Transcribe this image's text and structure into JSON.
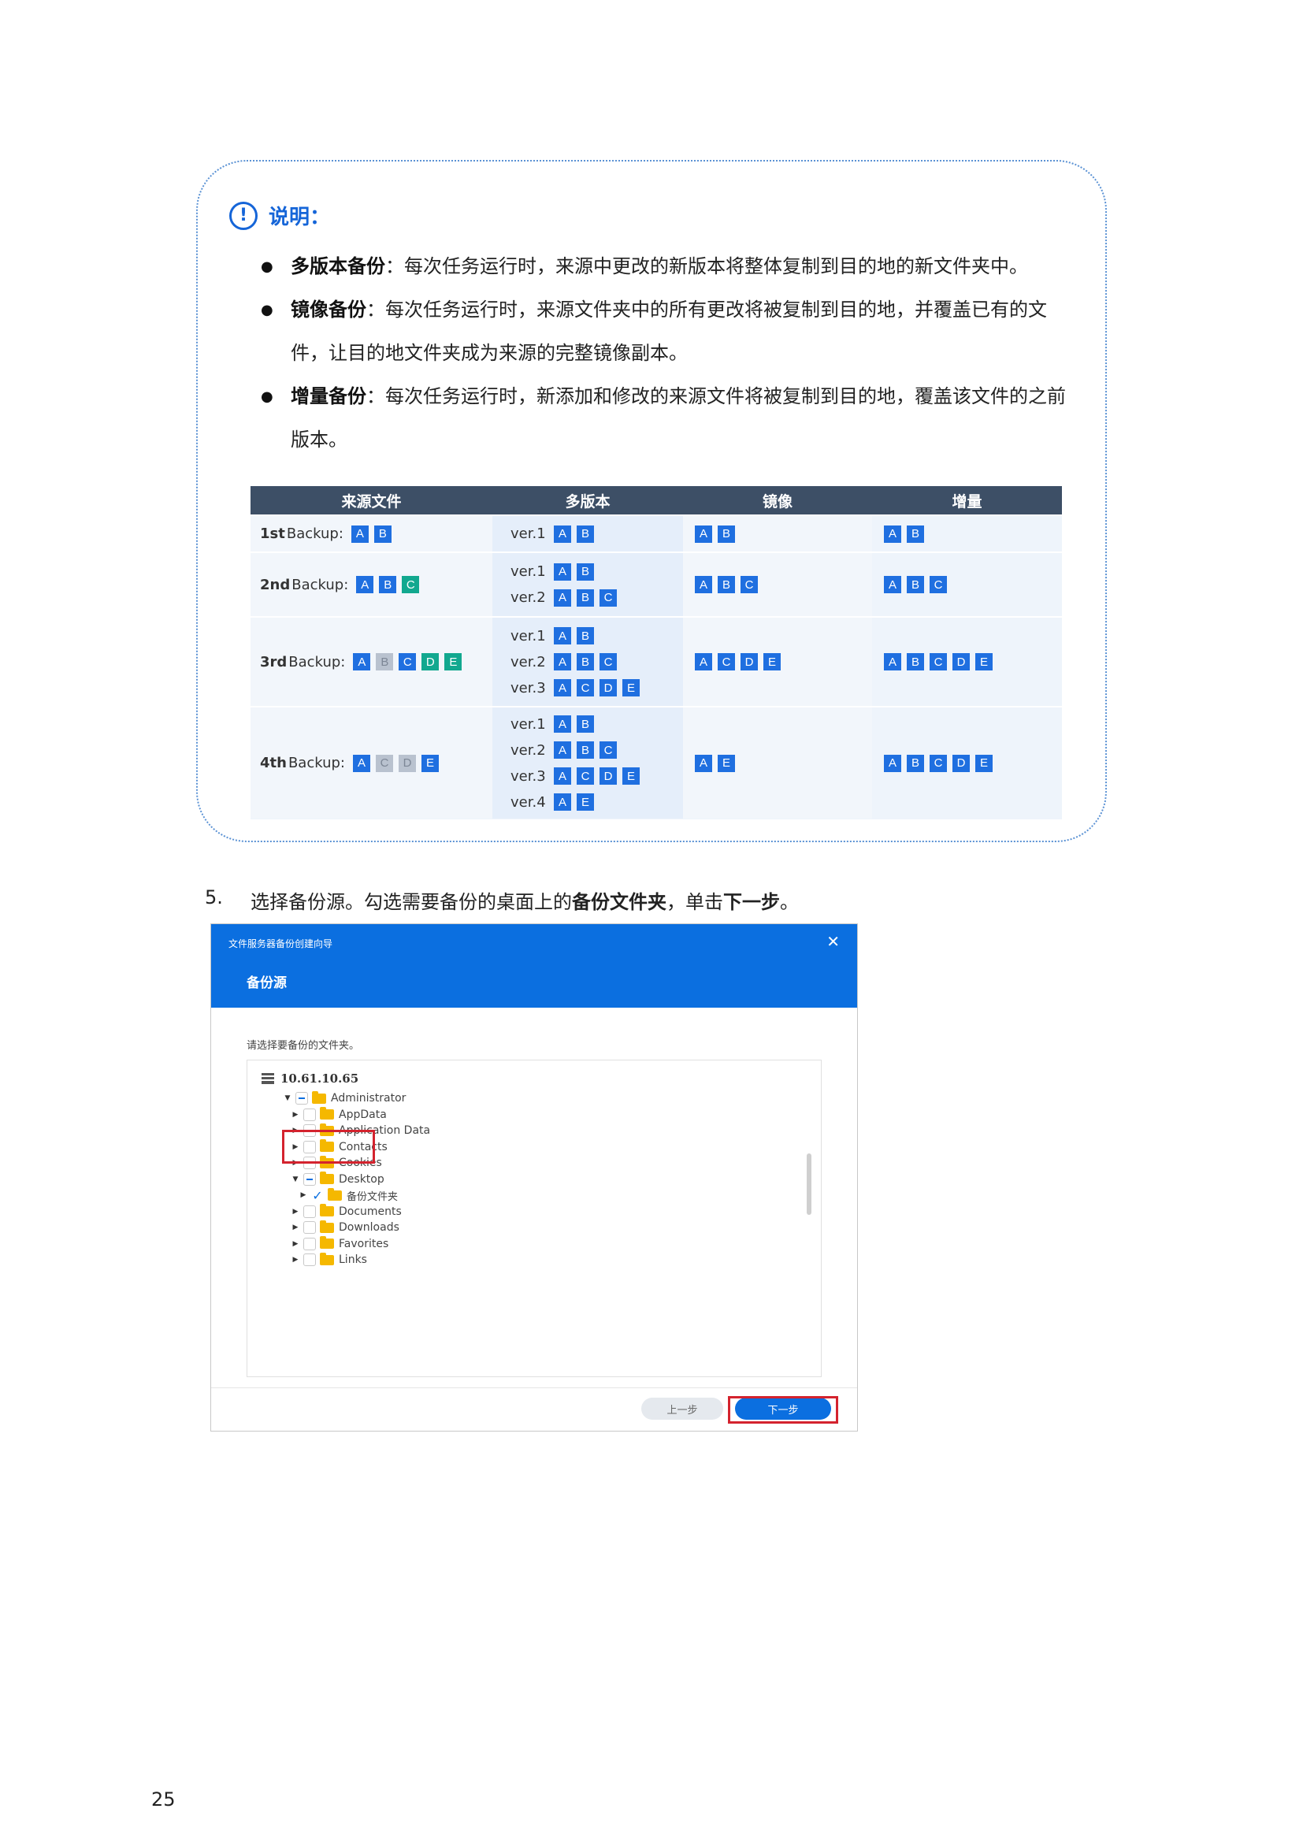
{
  "note": {
    "icon": "info-circle-icon",
    "title": "说明：",
    "items": [
      {
        "term": "多版本备份",
        "sep": "：",
        "text": "每次任务运行时，来源中更改的新版本将整体复制到目的地的新文件夹中。"
      },
      {
        "term": "镜像备份",
        "sep": "：",
        "text": "每次任务运行时，来源文件夹中的所有更改将被复制到目的地，并覆盖已有的文件，让目的地文件夹成为来源的完整镜像副本。"
      },
      {
        "term": "增量备份",
        "sep": "：",
        "text": "每次任务运行时，新添加和修改的来源文件将被复制到目的地，覆盖该文件的之前版本。"
      }
    ]
  },
  "table": {
    "headers": [
      "来源文件",
      "多版本",
      "镜像",
      "增量"
    ],
    "rows": [
      {
        "num": "1st",
        "label": "Backup:",
        "source": [
          {
            "l": "A",
            "s": "normal"
          },
          {
            "l": "B",
            "s": "normal"
          }
        ],
        "versions": [
          {
            "v": "ver.1",
            "chips": [
              "A",
              "B"
            ]
          }
        ],
        "mirror": [
          "A",
          "B"
        ],
        "incremental": [
          "A",
          "B"
        ]
      },
      {
        "num": "2nd",
        "label": "Backup:",
        "source": [
          {
            "l": "A",
            "s": "normal"
          },
          {
            "l": "B",
            "s": "normal"
          },
          {
            "l": "C",
            "s": "new"
          }
        ],
        "versions": [
          {
            "v": "ver.1",
            "chips": [
              "A",
              "B"
            ]
          },
          {
            "v": "ver.2",
            "chips": [
              "A",
              "B",
              "C"
            ]
          }
        ],
        "mirror": [
          "A",
          "B",
          "C"
        ],
        "incremental": [
          "A",
          "B",
          "C"
        ]
      },
      {
        "num": "3rd",
        "label": "Backup:",
        "source": [
          {
            "l": "A",
            "s": "normal"
          },
          {
            "l": "B",
            "s": "deleted"
          },
          {
            "l": "C",
            "s": "normal"
          },
          {
            "l": "D",
            "s": "new"
          },
          {
            "l": "E",
            "s": "new"
          }
        ],
        "versions": [
          {
            "v": "ver.1",
            "chips": [
              "A",
              "B"
            ]
          },
          {
            "v": "ver.2",
            "chips": [
              "A",
              "B",
              "C"
            ]
          },
          {
            "v": "ver.3",
            "chips": [
              "A",
              "C",
              "D",
              "E"
            ]
          }
        ],
        "mirror": [
          "A",
          "C",
          "D",
          "E"
        ],
        "incremental": [
          "A",
          "B",
          "C",
          "D",
          "E"
        ]
      },
      {
        "num": "4th",
        "label": "Backup:",
        "source": [
          {
            "l": "A",
            "s": "normal"
          },
          {
            "l": "C",
            "s": "deleted"
          },
          {
            "l": "D",
            "s": "deleted"
          },
          {
            "l": "E",
            "s": "normal"
          }
        ],
        "versions": [
          {
            "v": "ver.1",
            "chips": [
              "A",
              "B"
            ]
          },
          {
            "v": "ver.2",
            "chips": [
              "A",
              "B",
              "C"
            ]
          },
          {
            "v": "ver.3",
            "chips": [
              "A",
              "C",
              "D",
              "E"
            ]
          },
          {
            "v": "ver.4",
            "chips": [
              "A",
              "E"
            ]
          }
        ],
        "mirror": [
          "A",
          "E"
        ],
        "incremental": [
          "A",
          "B",
          "C",
          "D",
          "E"
        ]
      }
    ]
  },
  "step": {
    "number": "5.",
    "text1": "选择备份源。勾选需要备份的桌面上的",
    "bold1": "备份文件夹",
    "text2": "，单击",
    "bold2": "下一步",
    "text3": "。"
  },
  "dialog": {
    "window_title": "文件服务器备份创建向导",
    "close_icon": "close-icon",
    "heading": "备份源",
    "prompt": "请选择要备份的文件夹。",
    "server": "10.61.10.65",
    "tree": [
      {
        "name": "Administrator",
        "expanded": true,
        "state": "partial"
      },
      {
        "name": "AppData",
        "state": "empty"
      },
      {
        "name": "Application Data",
        "state": "empty"
      },
      {
        "name": "Contacts",
        "state": "empty"
      },
      {
        "name": "Cookies",
        "state": "empty"
      },
      {
        "name": "Desktop",
        "expanded": true,
        "state": "partial"
      },
      {
        "name": "备份文件夹",
        "state": "checked"
      },
      {
        "name": "Documents",
        "state": "empty"
      },
      {
        "name": "Downloads",
        "state": "empty"
      },
      {
        "name": "Favorites",
        "state": "empty"
      },
      {
        "name": "Links",
        "state": "empty"
      }
    ],
    "prev_button": "上一步",
    "next_button": "下一步"
  },
  "page_number": "25"
}
